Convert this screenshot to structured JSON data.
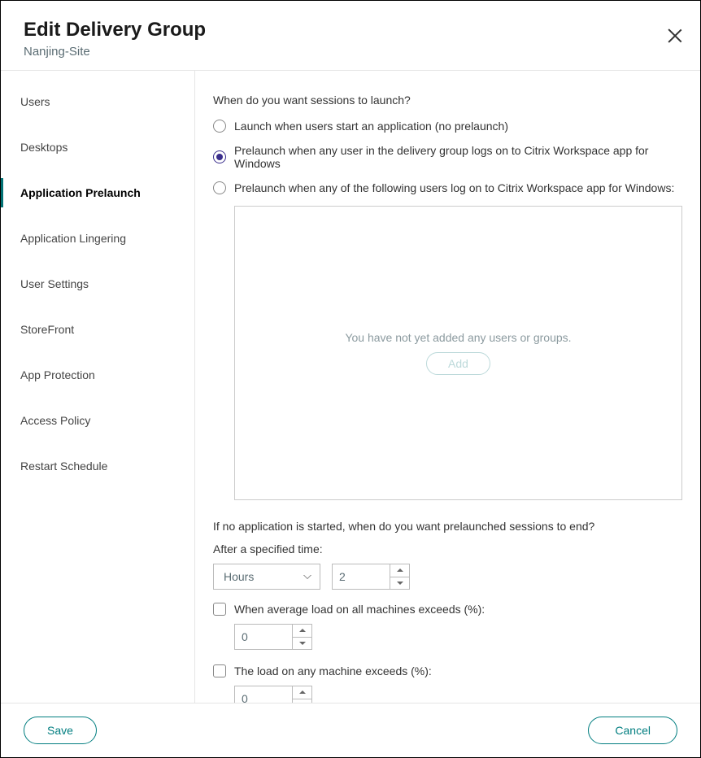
{
  "header": {
    "title": "Edit Delivery Group",
    "subtitle": "Nanjing-Site"
  },
  "sidebar": {
    "items": [
      {
        "label": "Users"
      },
      {
        "label": "Desktops"
      },
      {
        "label": "Application Prelaunch"
      },
      {
        "label": "Application Lingering"
      },
      {
        "label": "User Settings"
      },
      {
        "label": "StoreFront"
      },
      {
        "label": "App Protection"
      },
      {
        "label": "Access Policy"
      },
      {
        "label": "Restart Schedule"
      }
    ],
    "active_index": 2
  },
  "main": {
    "question": "When do you want sessions to launch?",
    "options": [
      "Launch when users start an application (no prelaunch)",
      "Prelaunch when any user in the delivery group logs on to Citrix Workspace app for Windows",
      "Prelaunch when any of the following users log on to Citrix Workspace app for Windows:"
    ],
    "selected_option": 1,
    "userbox_empty": "You have not yet added any users or groups.",
    "add_button": "Add",
    "end_question": "If no application is started, when do you want prelaunched sessions to end?",
    "after_specified": "After a specified time:",
    "time_unit": "Hours",
    "time_value": "2",
    "check_avg_load": "When average load on all machines exceeds (%):",
    "avg_load_value": "0",
    "check_any_load": "The load on any machine exceeds (%):",
    "any_load_value": "0"
  },
  "footer": {
    "save": "Save",
    "cancel": "Cancel"
  }
}
